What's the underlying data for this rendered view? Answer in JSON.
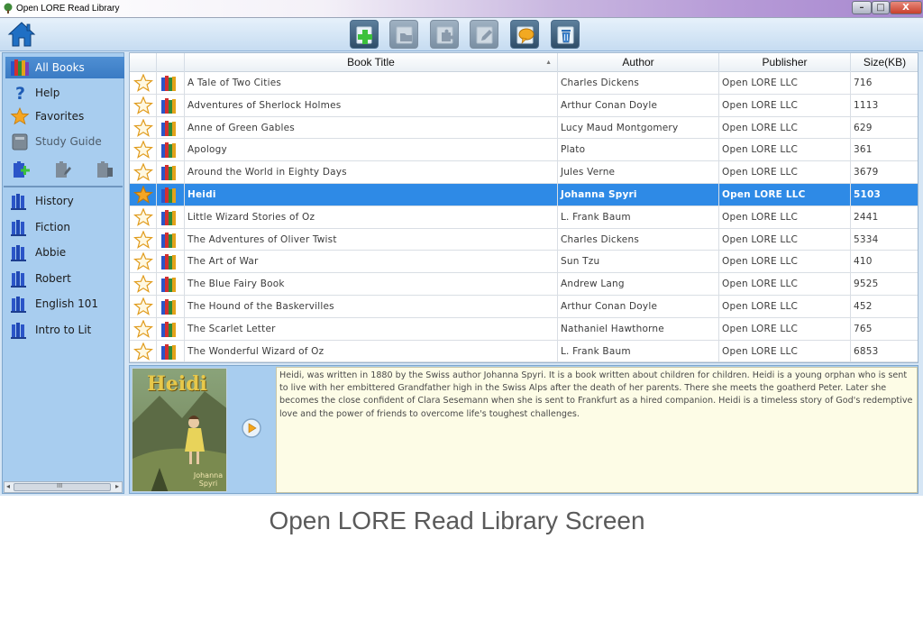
{
  "window": {
    "title": "Open LORE Read Library",
    "min_label": "–",
    "max_label": "□",
    "close_label": "X"
  },
  "toolbar": {
    "home_icon": "home-icon",
    "tools": [
      "add-book-icon",
      "folder-icon",
      "puzzle-icon",
      "edit-icon",
      "comment-icon",
      "trash-icon"
    ]
  },
  "sidebar": {
    "items": [
      {
        "label": "All Books",
        "icon": "books-icon",
        "selected": true
      },
      {
        "label": "Help",
        "icon": "help-icon"
      },
      {
        "label": "Favorites",
        "icon": "star-icon"
      },
      {
        "label": "Study Guide",
        "icon": "study-guide-icon",
        "disabled": true
      }
    ],
    "shelves": [
      {
        "label": "History"
      },
      {
        "label": "Fiction"
      },
      {
        "label": "Abbie"
      },
      {
        "label": "Robert"
      },
      {
        "label": "English 101"
      },
      {
        "label": "Intro to Lit"
      }
    ],
    "scroll_grip": "III"
  },
  "grid": {
    "columns": {
      "title": "Book Title",
      "author": "Author",
      "publisher": "Publisher",
      "size": "Size(KB)"
    },
    "sort_indicator": "▲",
    "rows": [
      {
        "title": "A Tale of Two Cities",
        "author": "Charles Dickens",
        "publisher": "Open LORE LLC",
        "size": "716",
        "favorite": false
      },
      {
        "title": "Adventures of Sherlock Holmes",
        "author": "Arthur Conan Doyle",
        "publisher": "Open LORE LLC",
        "size": "1113",
        "favorite": false
      },
      {
        "title": "Anne of Green Gables",
        "author": "Lucy Maud Montgomery",
        "publisher": "Open LORE LLC",
        "size": "629",
        "favorite": false
      },
      {
        "title": "Apology",
        "author": "Plato",
        "publisher": "Open LORE LLC",
        "size": "361",
        "favorite": false
      },
      {
        "title": "Around the World in Eighty Days",
        "author": "Jules Verne",
        "publisher": "Open LORE LLC",
        "size": "3679",
        "favorite": false
      },
      {
        "title": "Heidi",
        "author": "Johanna Spyri",
        "publisher": "Open LORE LLC",
        "size": "5103",
        "favorite": true,
        "selected": true
      },
      {
        "title": "Little Wizard Stories of Oz",
        "author": "L. Frank Baum",
        "publisher": "Open LORE LLC",
        "size": "2441",
        "favorite": false
      },
      {
        "title": "The Adventures of Oliver Twist",
        "author": "Charles Dickens",
        "publisher": "Open LORE LLC",
        "size": "5334",
        "favorite": false
      },
      {
        "title": "The Art of War",
        "author": "Sun Tzu",
        "publisher": "Open LORE LLC",
        "size": "410",
        "favorite": false
      },
      {
        "title": "The Blue Fairy Book",
        "author": "Andrew Lang",
        "publisher": "Open LORE LLC",
        "size": "9525",
        "favorite": false
      },
      {
        "title": "The Hound of the Baskervilles",
        "author": "Arthur Conan Doyle",
        "publisher": "Open LORE LLC",
        "size": "452",
        "favorite": false
      },
      {
        "title": "The Scarlet Letter",
        "author": "Nathaniel Hawthorne",
        "publisher": "Open LORE LLC",
        "size": "765",
        "favorite": false
      },
      {
        "title": "The Wonderful Wizard of Oz",
        "author": "L. Frank Baum",
        "publisher": "Open LORE LLC",
        "size": "6853",
        "favorite": false
      }
    ]
  },
  "details": {
    "cover_title": "Heidi",
    "cover_author": "Johanna Spyri",
    "description": "Heidi, was written in 1880 by the Swiss author Johanna Spyri. It is a book written about children for children. Heidi is a young orphan who is sent to live with her embittered Grandfather high in the Swiss Alps after the death of her parents. There she meets the goatherd Peter. Later she becomes the close confident of Clara Sesemann when she is sent to Frankfurt as a hired companion. Heidi is a timeless story of God's redemptive love and the power of friends to overcome life's toughest challenges."
  },
  "caption": "Open LORE Read Library Screen",
  "colors": {
    "selection": "#2e8ae6",
    "sidebar": "#a8cdef",
    "description_bg": "#fdfce6"
  }
}
